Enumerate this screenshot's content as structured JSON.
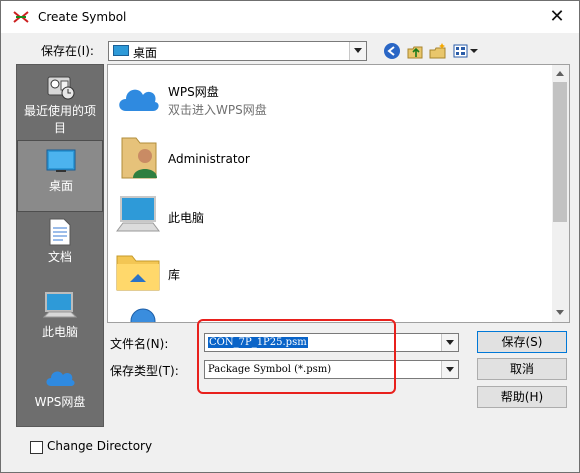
{
  "window": {
    "title": "Create Symbol",
    "close_glyph": "✕"
  },
  "save_in": {
    "label": "保存在(I):",
    "value": "桌面"
  },
  "toolbar": {
    "icons": [
      "back-icon",
      "up-folder-icon",
      "new-folder-icon",
      "view-menu-icon"
    ]
  },
  "places": [
    {
      "label": "最近使用的项目",
      "icon": "recent-icon"
    },
    {
      "label": "桌面",
      "icon": "desktop-icon",
      "selected": true
    },
    {
      "label": "文档",
      "icon": "documents-icon"
    },
    {
      "label": "此电脑",
      "icon": "computer-icon"
    },
    {
      "label": "WPS网盘",
      "icon": "cloud-icon"
    }
  ],
  "files": [
    {
      "name": "WPS网盘",
      "sub": "双击进入WPS网盘",
      "icon": "wps-cloud-icon"
    },
    {
      "name": "Administrator",
      "icon": "user-folder-icon"
    },
    {
      "name": "此电脑",
      "icon": "computer-icon"
    },
    {
      "name": "库",
      "icon": "library-icon"
    }
  ],
  "filename": {
    "label": "文件名(N):",
    "value": "CON_7P_1P25.psm"
  },
  "filetype": {
    "label": "保存类型(T):",
    "value": "Package Symbol (*.psm)"
  },
  "buttons": {
    "save": "保存(S)",
    "cancel": "取消",
    "help": "帮助(H)"
  },
  "change_directory": {
    "label": "Change Directory",
    "checked": false
  },
  "colors": {
    "accent": "#0078d7",
    "highlight": "#e8201c",
    "sidebar": "#6e6e6e"
  }
}
